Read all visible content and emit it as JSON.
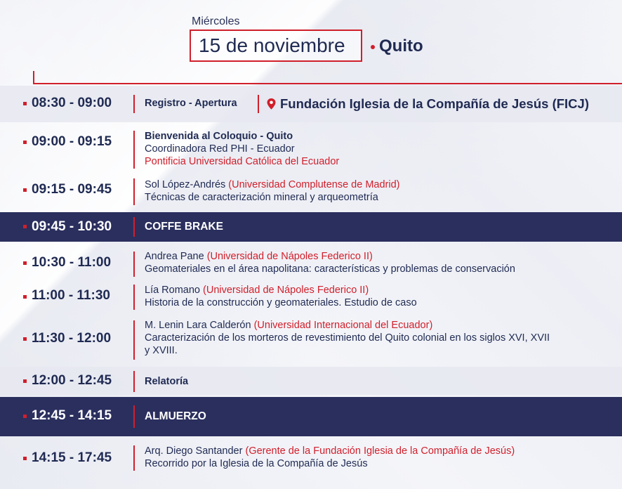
{
  "header": {
    "weekday": "Miércoles",
    "date": "15 de noviembre",
    "city": "Quito"
  },
  "accent_color": "#d01f2b",
  "dark_band_color": "#2b2f5e",
  "schedule": [
    {
      "time": "08:30 - 09:00",
      "title": "Registro - Apertura",
      "venue_icon": "map-pin-icon",
      "venue": "Fundación Iglesia de la Compañía de Jesús (FICJ)"
    },
    {
      "time": "09:00 - 09:15",
      "title": "Bienvenida al Coloquio - Quito",
      "line2": "Coordinadora Red PHI - Ecuador",
      "line3": "Pontificia Universidad Católica del Ecuador"
    },
    {
      "time": "09:15 - 09:45",
      "speaker": "Sol López-Andrés",
      "affiliation": "(Universidad Complutense de Madrid)",
      "talk": "Técnicas de caracterización mineral y arqueometría"
    },
    {
      "time": "09:45 - 10:30",
      "title": "COFFE BRAKE"
    },
    {
      "time": "10:30 - 11:00",
      "speaker": "Andrea Pane",
      "affiliation": "(Universidad de Nápoles Federico II)",
      "talk": "Geomateriales en el área napolitana: características y problemas de conservación"
    },
    {
      "time": "11:00 - 11:30",
      "speaker": "Lía Romano",
      "affiliation": "(Universidad de Nápoles Federico II)",
      "talk": "Historia de la construcción y geomateriales. Estudio de caso"
    },
    {
      "time": "11:30 - 12:00",
      "speaker": "M. Lenin Lara Calderón",
      "affiliation": "(Universidad  Internacional del Ecuador)",
      "talk_line1": "Caracterización de los morteros de revestimiento del Quito colonial en los siglos XVI, XVII",
      "talk_line2": "y XVIII."
    },
    {
      "time": "12:00 - 12:45",
      "title": "Relatoría"
    },
    {
      "time": "12:45 - 14:15",
      "title": "ALMUERZO"
    },
    {
      "time": "14:15 - 17:45",
      "speaker": "Arq. Diego Santander",
      "affiliation": "(Gerente de la Fundación Iglesia de la Compañía de Jesús)",
      "talk": "Recorrido por la Iglesia de la Compañía de Jesús"
    }
  ]
}
